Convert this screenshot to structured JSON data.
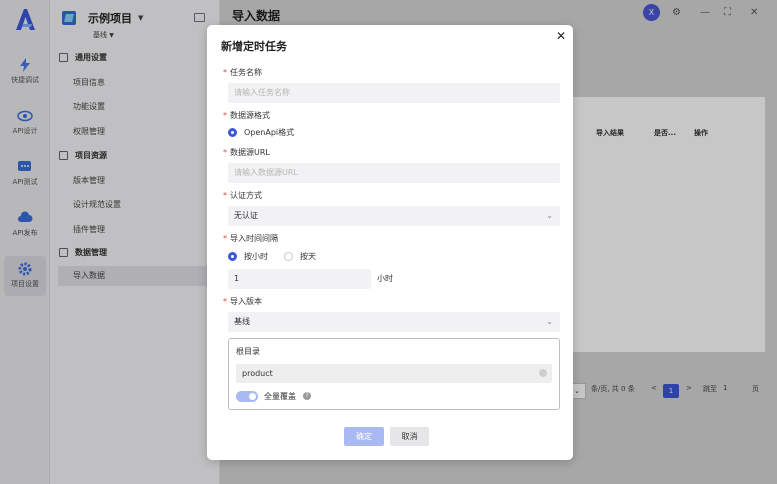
{
  "app": {
    "page_title": "导入数据",
    "user_initial": "X"
  },
  "rail": [
    {
      "label": "快捷调试",
      "icon": "lightning-icon"
    },
    {
      "label": "API设计",
      "icon": "eye-icon"
    },
    {
      "label": "API测试",
      "icon": "chat-icon"
    },
    {
      "label": "API发布",
      "icon": "cloud-icon"
    },
    {
      "label": "项目设置",
      "icon": "gear-icon"
    }
  ],
  "project": {
    "name": "示例项目",
    "branch": "基线"
  },
  "nav": {
    "groups": [
      {
        "title": "通用设置",
        "items": [
          "项目信息",
          "功能设置",
          "权限管理"
        ]
      },
      {
        "title": "项目资源",
        "items": [
          "版本管理",
          "设计规范设置",
          "插件管理"
        ]
      },
      {
        "title": "数据管理",
        "items": [
          "导入数据"
        ]
      }
    ]
  },
  "table": {
    "headers": [
      "导入结果",
      "是否...",
      "操作"
    ]
  },
  "pager": {
    "per_page": "条/页, 共 0 条",
    "prev": "<",
    "current": "1",
    "next": ">",
    "goto": "跳至",
    "goto_value": "1",
    "page_unit": "页"
  },
  "modal": {
    "title": "新增定时任务",
    "task_name": {
      "label": "任务名称",
      "placeholder": "请输入任务名称"
    },
    "source_format": {
      "label": "数据源格式",
      "option": "OpenApi格式"
    },
    "source_url": {
      "label": "数据源URL",
      "placeholder": "请输入数据源URL"
    },
    "auth": {
      "label": "认证方式",
      "value": "无认证"
    },
    "interval": {
      "label": "导入时间间隔",
      "options": [
        "按小时",
        "按天"
      ],
      "value": "1",
      "unit": "小时"
    },
    "version": {
      "label": "导入版本",
      "value": "基线"
    },
    "root": {
      "label": "根目录",
      "value": "product"
    },
    "overwrite": {
      "label": "全量覆盖",
      "on": true
    },
    "ok": "确定",
    "cancel": "取消"
  }
}
